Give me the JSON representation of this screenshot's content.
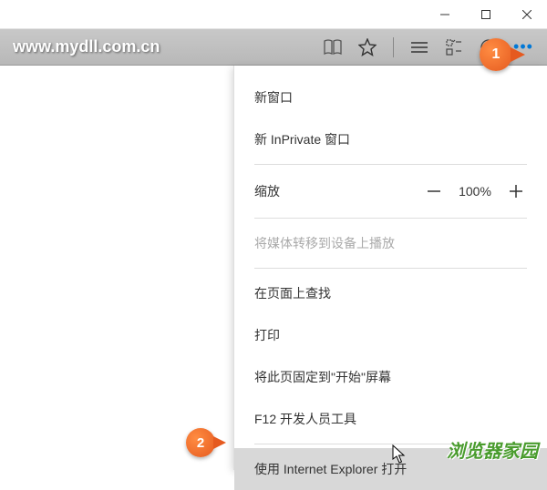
{
  "window": {
    "minimize": "—",
    "maximize": "□",
    "close": "×"
  },
  "toolbar": {
    "url": "www.mydll.com.cn"
  },
  "callouts": {
    "one": "1",
    "two": "2"
  },
  "zoom": {
    "label": "缩放",
    "value": "100%"
  },
  "menu": {
    "new_window": "新窗口",
    "new_inprivate": "新 InPrivate 窗口",
    "cast": "将媒体转移到设备上播放",
    "find": "在页面上查找",
    "print": "打印",
    "pin": "将此页固定到\"开始\"屏幕",
    "devtools": "F12 开发人员工具",
    "open_ie": "使用 Internet Explorer 打开"
  },
  "watermark": "浏览器家园"
}
